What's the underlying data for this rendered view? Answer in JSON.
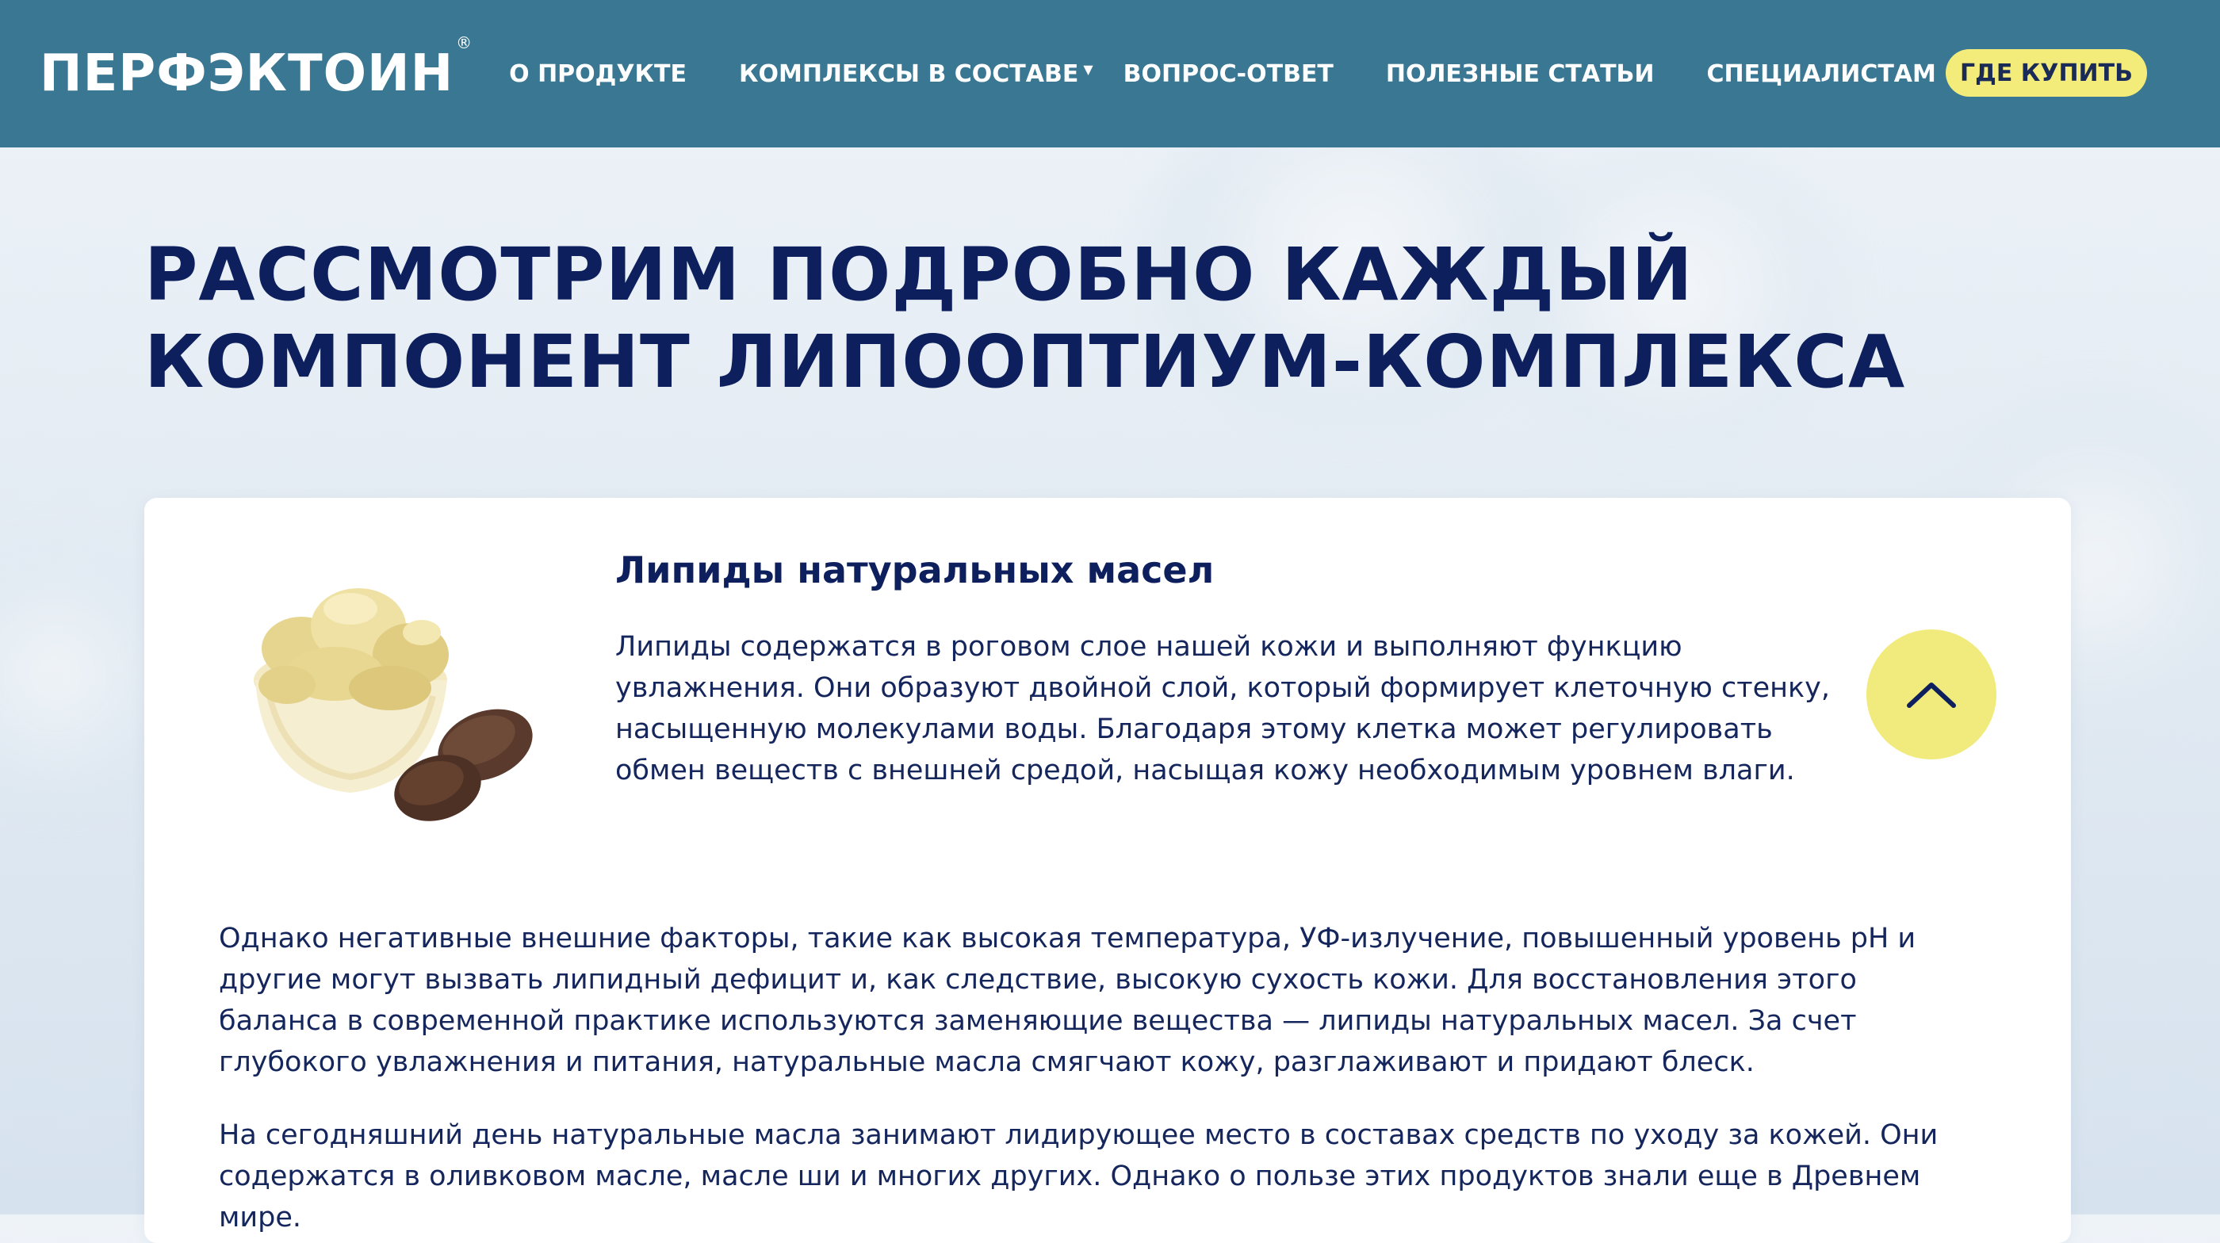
{
  "header": {
    "logo_text": "ПЕРФЭКТОИН",
    "logo_mark": "®",
    "nav": [
      {
        "label": "О ПРОДУКТЕ"
      },
      {
        "label": "КОМПЛЕКСЫ В СОСТАВЕ",
        "dropdown_icon": "caret-down-icon"
      },
      {
        "label": "ВОПРОС-ОТВЕТ"
      },
      {
        "label": "ПОЛЕЗНЫЕ СТАТЬИ"
      },
      {
        "label": "СПЕЦИАЛИСТАМ"
      }
    ],
    "buy_button_label": "ГДЕ КУПИТЬ",
    "colors": {
      "header_bg": "#3a7792",
      "buy_button_bg": "#f3ec7a"
    }
  },
  "main": {
    "title_line_1": "РАССМОТРИМ ПОДРОБНО КАЖДЫЙ",
    "title_line_2": "КОМПОНЕНТ ЛИПООПТИУМ-КОМПЛЕКСА"
  },
  "card": {
    "heading": "Липиды натуральных масел",
    "intro": "Липиды содержатся в роговом слое нашей кожи и выполняют функцию увлажнения. Они образуют двойной слой, который формирует клеточную стенку, насыщенную молекулами воды. Благодаря этому клетка может регулировать обмен веществ с внешней средой, насыщая кожу необходимым уровнем влаги.",
    "paragraphs": [
      "Однако негативные внешние факторы, такие как высокая температура, УФ-излучение, повышенный уровень pH и другие могут вызвать липидный дефицит и, как следствие, высокую сухость кожи. Для восстановления этого баланса в современной практике используются заменяющие вещества — липиды натуральных масел. За счет глубокого увлажнения и питания, натуральные масла смягчают кожу, разглаживают и придают блеск.",
      "На сегодняшний день натуральные масла занимают лидирующее место в составах средств по уходу за кожей. Они содержатся в оливковом масле, масле ши и многих других. Однако о пользе этих продуктов знали еще в Древнем мире."
    ],
    "collapse_icon": "chevron-up-icon",
    "illustration": "shea-butter-bowl-with-nuts-image",
    "colors": {
      "text": "#14265c",
      "heading": "#0d1f5c",
      "collapse_button_bg": "#f1ea7c"
    }
  }
}
